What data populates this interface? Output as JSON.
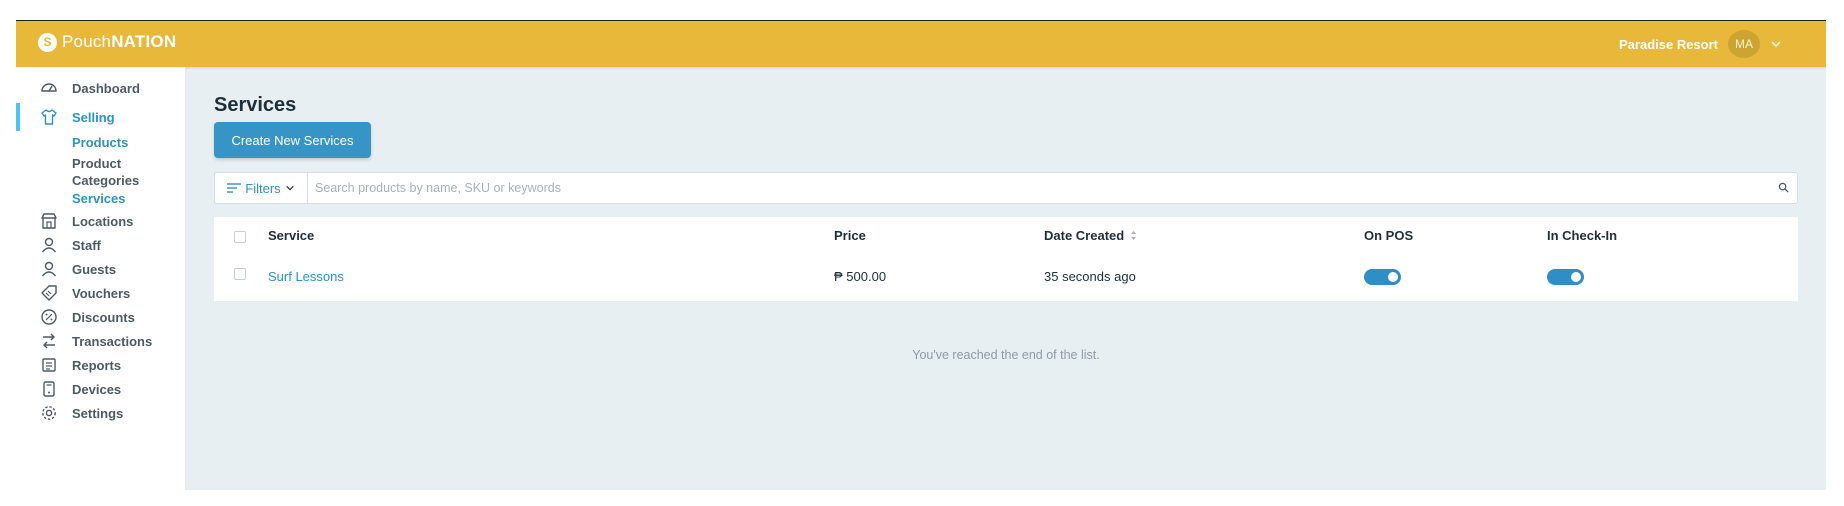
{
  "brand": {
    "logo_mark": "S",
    "name_light": "Pouch",
    "name_bold": "NATION"
  },
  "header": {
    "venue_name": "Paradise Resort",
    "avatar_initials": "MA"
  },
  "sidebar": {
    "items": [
      {
        "label": "Dashboard",
        "icon": "speedometer-icon"
      },
      {
        "label": "Selling",
        "icon": "shirt-icon",
        "active": true,
        "subitems": [
          {
            "label": "Products"
          },
          {
            "label": "Product Categories"
          },
          {
            "label": "Services",
            "active": true
          }
        ]
      },
      {
        "label": "Locations",
        "icon": "store-icon"
      },
      {
        "label": "Staff",
        "icon": "person-icon"
      },
      {
        "label": "Guests",
        "icon": "person-icon"
      },
      {
        "label": "Vouchers",
        "icon": "voucher-tag-icon"
      },
      {
        "label": "Discounts",
        "icon": "percent-icon"
      },
      {
        "label": "Transactions",
        "icon": "transfer-icon"
      },
      {
        "label": "Reports",
        "icon": "report-icon"
      },
      {
        "label": "Devices",
        "icon": "device-icon"
      },
      {
        "label": "Settings",
        "icon": "gear-icon"
      }
    ]
  },
  "main": {
    "title": "Services",
    "create_button": "Create New Services",
    "filters_label": "Filters",
    "search_placeholder": "Search products by name, SKU or keywords",
    "table": {
      "columns": [
        "Service",
        "Price",
        "Date Created",
        "On POS",
        "In Check-In"
      ],
      "rows": [
        {
          "service": "Surf Lessons",
          "price": "₱ 500.00",
          "date_created": "35 seconds ago",
          "on_pos": true,
          "in_check_in": true
        }
      ]
    },
    "end_of_list": "You've reached the end of the list."
  },
  "colors": {
    "header": "#e7b83a",
    "accent": "#2b93c5",
    "button": "#3794c7",
    "active_bar": "#4fc3f2",
    "background": "#e7eff2"
  }
}
